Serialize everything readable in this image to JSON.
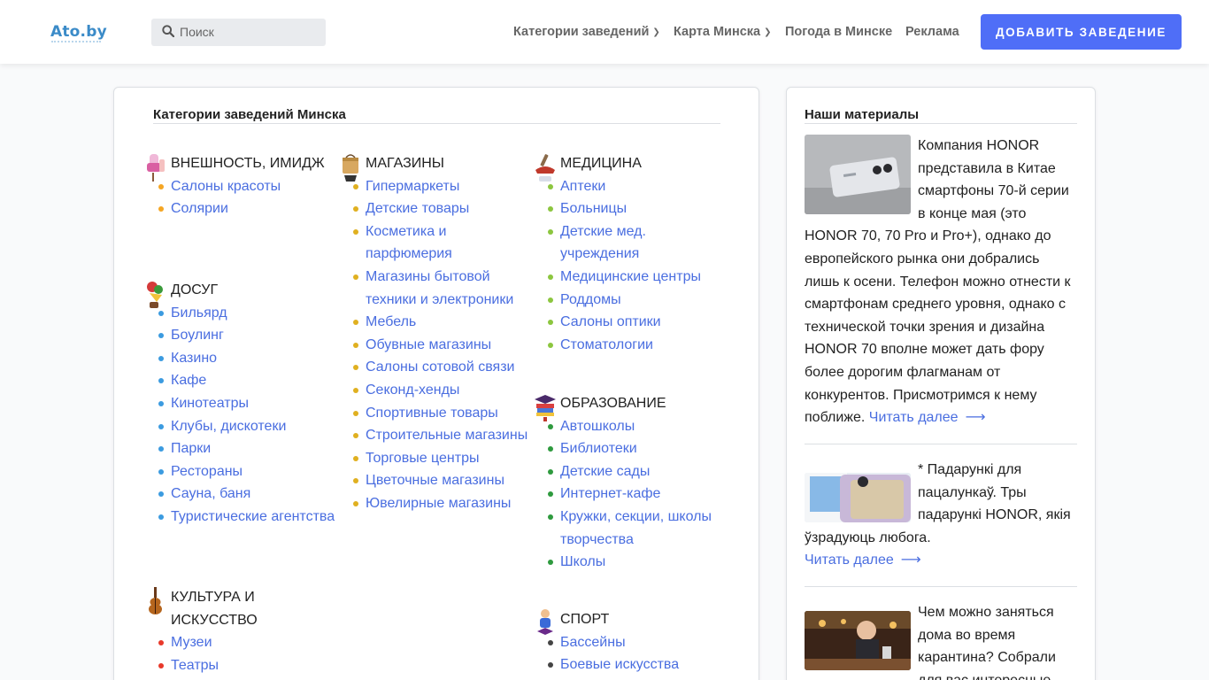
{
  "header": {
    "logo": "Ato.by",
    "search_placeholder": "Поиск",
    "nav": [
      {
        "label": "Категории заведений",
        "dropdown": true
      },
      {
        "label": "Карта Минска",
        "dropdown": true
      },
      {
        "label": "Погода в Минске",
        "dropdown": false
      },
      {
        "label": "Реклама",
        "dropdown": false
      }
    ],
    "add_button": "Добавить заведение"
  },
  "main": {
    "title": "Категории заведений Минска",
    "categories": [
      {
        "name": "Внешность, имидж",
        "icon": "cosmetics-icon",
        "dot_color": "#f5a623",
        "items": [
          "Салоны красоты",
          "Солярии"
        ]
      },
      {
        "name": "Досуг",
        "icon": "party-icon",
        "dot_color": "#3b9be0",
        "items": [
          "Бильярд",
          "Боулинг",
          "Казино",
          "Кафе",
          "Кинотеатры",
          "Клубы, дискотеки",
          "Парки",
          "Рестораны",
          "Сауна, баня",
          "Туристические агентства"
        ]
      },
      {
        "name": "Культура и искусство",
        "icon": "violin-icon",
        "dot_color": "#e8392a",
        "items": [
          "Музеи",
          "Театры"
        ]
      },
      {
        "name": "Магазины",
        "icon": "shopping-bag-icon",
        "dot_color": "#e0b020",
        "items": [
          "Гипермаркеты",
          "Детские товары",
          "Косметика и парфюмерия",
          "Магазины бытовой техники и электроники",
          "Мебель",
          "Обувные магазины",
          "Салоны сотовой связи",
          "Секонд-хенды",
          "Спортивные товары",
          "Строительные магазины",
          "Торговые центры",
          "Цветочные магазины",
          "Ювелирные магазины"
        ]
      },
      {
        "name": "Медицина",
        "icon": "medicine-icon",
        "dot_color": "#8cc63f",
        "items": [
          "Аптеки",
          "Больницы",
          "Детские мед. учреждения",
          "Медицинские центры",
          "Роддомы",
          "Салоны оптики",
          "Стоматологии"
        ]
      },
      {
        "name": "Образование",
        "icon": "books-icon",
        "dot_color": "#2e9a3e",
        "items": [
          "Автошколы",
          "Библиотеки",
          "Детские сады",
          "Интернет-кафе",
          "Кружки, секции, школы творчества",
          "Школы"
        ]
      },
      {
        "name": "Спорт",
        "icon": "athlete-icon",
        "dot_color": "#444444",
        "items": [
          "Бассейны",
          "Боевые искусства"
        ]
      }
    ]
  },
  "sidebar": {
    "title": "Наши материалы",
    "read_more": "Читать далее",
    "articles": [
      {
        "text": "Компания HONOR представила в Китае смартфоны 70-й серии в конце мая (это HONOR 70, 70 Pro и Pro+), однако до европейского рынка они добрались лишь к осени. Телефон можно отнести к смартфонам среднего уровня, однако с технической точки зрения и дизайна HONOR 70 вполне может дать фору более дорогим флагманам от конкурентов. Присмотримся к нему поближе.",
        "thumb": "phone-photo"
      },
      {
        "text": "* Падарункі для пацалункаў. Тры падарункі HONOR, якія ўзрадуюць любога.",
        "thumb": "phone-box-photo"
      },
      {
        "text": "Чем можно заняться дома во время карантина? Собрали для вас интересные",
        "thumb": "cafe-photo"
      }
    ]
  }
}
